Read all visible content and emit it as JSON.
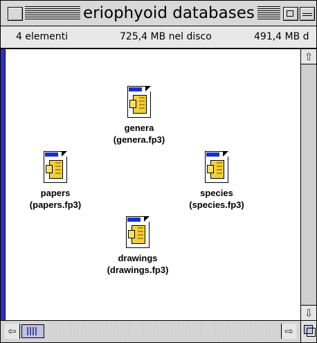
{
  "window": {
    "title": "eriophyoid databases"
  },
  "infobar": {
    "item_count": "4 elementi",
    "disk_used": "725,4 MB nel disco",
    "disk_free": "491,4 MB d"
  },
  "icons": [
    {
      "name": "genera",
      "file": "(genera.fp3)",
      "icon": "filemaker-document-icon"
    },
    {
      "name": "papers",
      "file": "(papers.fp3)",
      "icon": "filemaker-document-icon"
    },
    {
      "name": "species",
      "file": "(species.fp3)",
      "icon": "filemaker-document-icon"
    },
    {
      "name": "drawings",
      "file": "(drawings.fp3)",
      "icon": "filemaker-document-icon"
    }
  ],
  "colors": {
    "accent_blue": "#1830c8",
    "thumb": "#c0c0e8"
  }
}
